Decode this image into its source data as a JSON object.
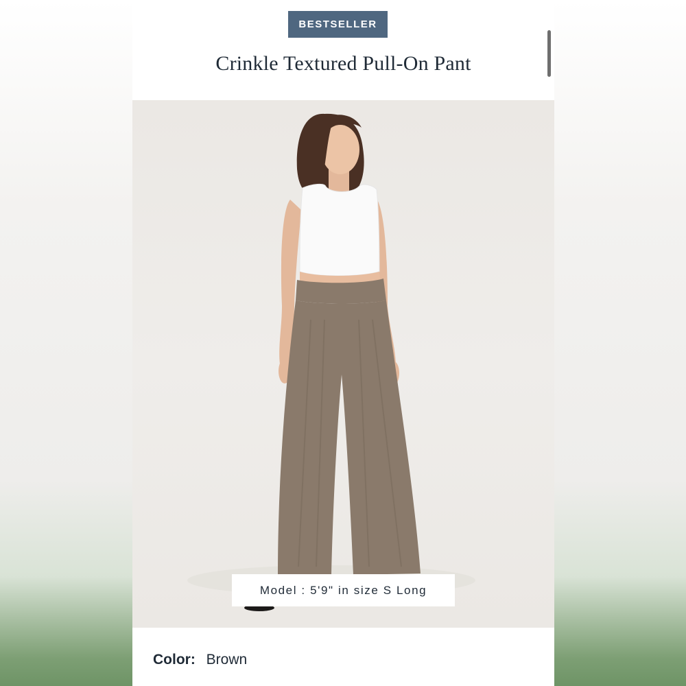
{
  "product": {
    "badge": "BESTSELLER",
    "title": "Crinkle Textured Pull-On Pant",
    "model_caption": "Model : 5'9\" in size S Long",
    "color_label": "Color:",
    "color_value": "Brown"
  },
  "colors": {
    "badge_bg": "#4f6780",
    "title_text": "#1f2a36",
    "pant": "#8a7a6b",
    "photo_bg": "#ebe8e4"
  },
  "image": {
    "alt_icon": "product-photo"
  }
}
